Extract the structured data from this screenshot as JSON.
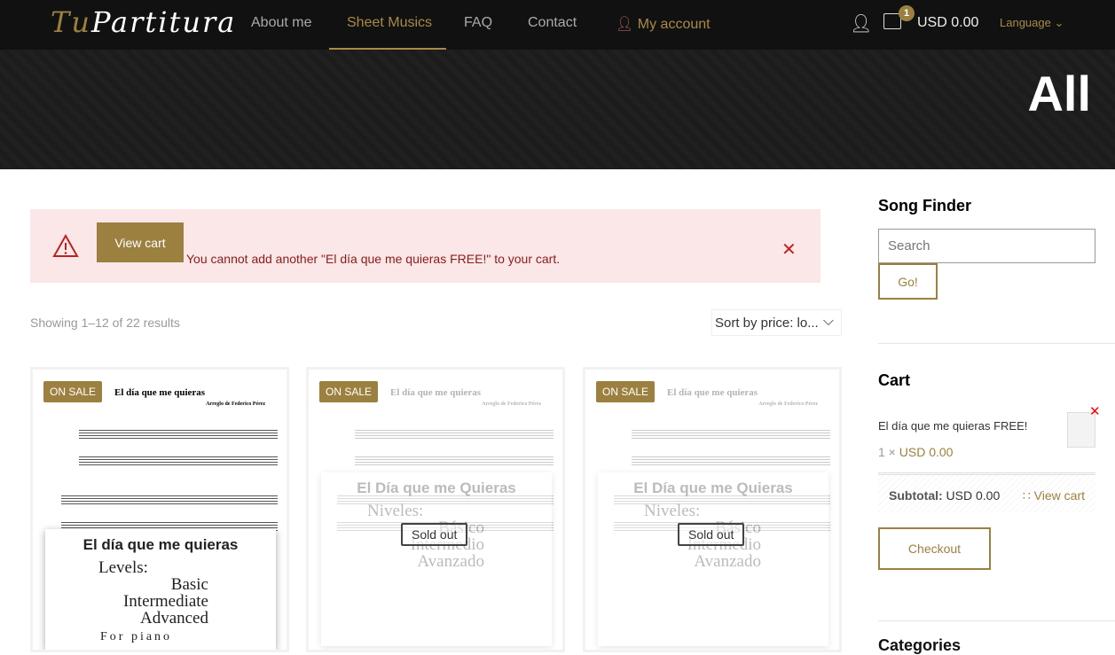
{
  "nav": {
    "logo_tu": "Tu",
    "logo_rest": "Partitura",
    "items": [
      "About me",
      "Sheet Musics",
      "FAQ",
      "Contact",
      "My account"
    ],
    "active": "Sheet Musics",
    "cart_count": "1",
    "cart_total": "USD 0.00",
    "language": "Language",
    "accent": "#a88a48"
  },
  "hero": {
    "title": "All"
  },
  "alert": {
    "button": "View cart",
    "message": "You cannot add another \"El día que me quieras FREE!\" to your cart."
  },
  "shop": {
    "showing": "Showing 1–12 of 22 results",
    "sort": "Sort by price: lo..."
  },
  "products": [
    {
      "badge": "ON SALE",
      "sheet_title": "El día que me quieras",
      "arranger": "Arreglo de Federico Pérez",
      "cover_title": "El día que me quieras",
      "levels_label": "Levels:",
      "levels": [
        "Basic",
        "Intermediate",
        "Advanced"
      ],
      "note": "For piano"
    },
    {
      "badge": "ON SALE",
      "sheet_title": "El día que me quieras",
      "arranger": "Arreglo de Federico Pérez",
      "cover_title": "El Día que me Quieras",
      "levels_label": "Niveles:",
      "levels": [
        "Básico",
        "Intermedio",
        "Avanzado"
      ],
      "status": "Sold out"
    },
    {
      "badge": "ON SALE",
      "sheet_title": "El día que me quieras",
      "arranger": "Arreglo de Federico Pérez",
      "cover_title": "El Día que me Quieras",
      "levels_label": "Niveles:",
      "levels": [
        "Básico",
        "Intermedio",
        "Avanzado"
      ],
      "status": "Sold out"
    }
  ],
  "sidebar": {
    "finder_title": "Song Finder",
    "search_placeholder": "Search",
    "go": "Go!",
    "cart_title": "Cart",
    "cart_item": "El día que me quieras FREE!",
    "qty": "1 ×",
    "price": "USD 0.00",
    "subtotal_label": "Subtotal:",
    "subtotal": "USD 0.00",
    "view_cart": "View cart",
    "checkout": "Checkout",
    "categories_title": "Categories"
  }
}
